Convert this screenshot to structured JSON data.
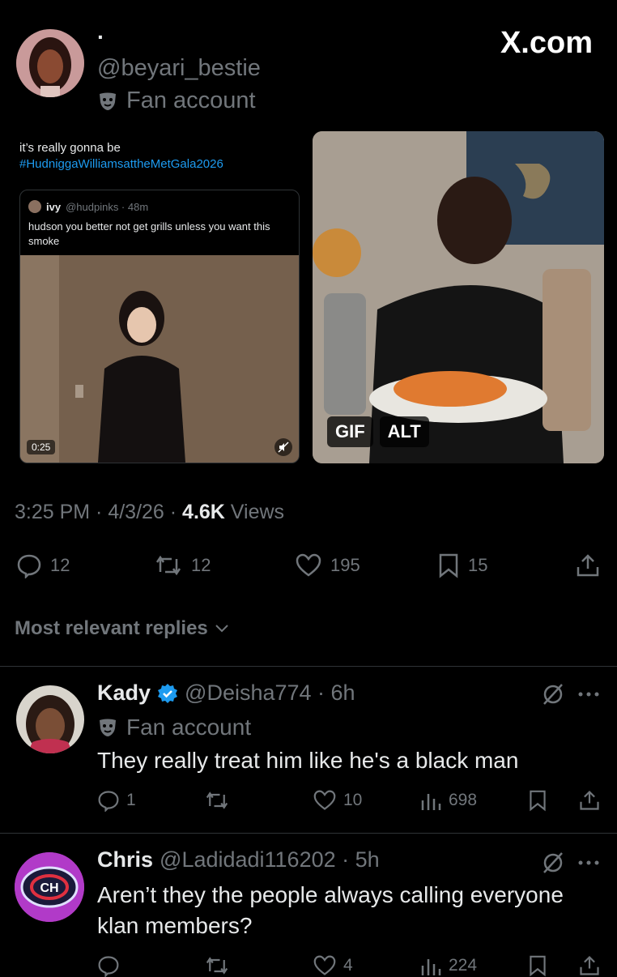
{
  "post": {
    "display_name": "·",
    "handle": "@beyari_bestie",
    "badge_label": "Fan account",
    "watermark": "X.com",
    "screenshot_text_line1": "it’s really gonna be",
    "screenshot_hashtag": "#HudniggaWilliamsattheMetGala2026",
    "quote": {
      "name": "ivy",
      "handle_time": "@hudpinks · 48m",
      "text": "hudson you better not get grills unless you want this smoke",
      "video_duration": "0:25"
    },
    "media_badges": [
      "GIF",
      "ALT"
    ],
    "meta": {
      "time": "3:25 PM · 4/3/26 · ",
      "views_count": "4.6K",
      "views_label": " Views"
    },
    "actions": {
      "replies": "12",
      "reposts": "12",
      "likes": "195",
      "bookmarks": "15"
    },
    "replies_sort": "Most relevant replies"
  },
  "replies": [
    {
      "name": "Kady",
      "handle_time": "@Deisha774 · 6h",
      "badge_label": "Fan account",
      "text": "They really treat him like he's a black man",
      "actions": {
        "replies": "1",
        "reposts": "",
        "likes": "10",
        "views": "698"
      }
    },
    {
      "name": "Chris",
      "handle_time": "@Ladidadi116202 · 5h",
      "text": "Aren’t they the people always calling everyone klan members?",
      "actions": {
        "replies": "",
        "reposts": "",
        "likes": "4",
        "views": "224"
      }
    }
  ],
  "colors": {
    "accent": "#1d9bf0",
    "muted": "#71767b",
    "text": "#e7e9ea",
    "background": "#000000"
  }
}
